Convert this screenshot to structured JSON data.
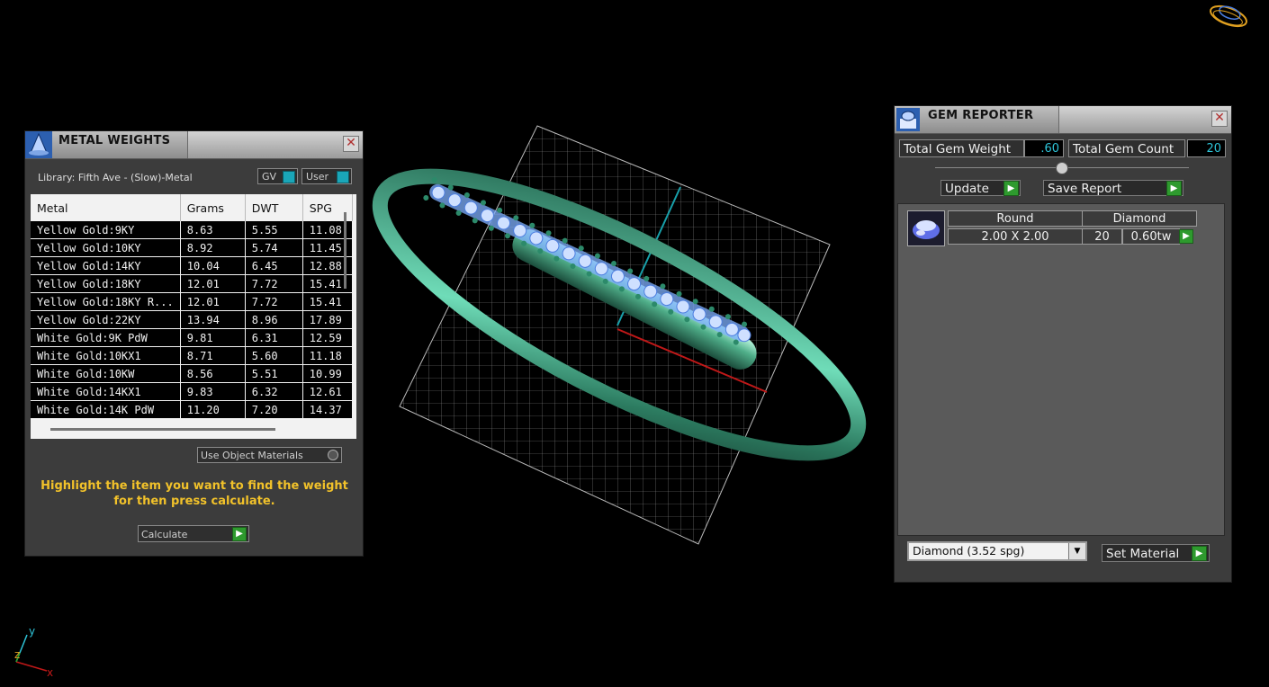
{
  "metal_weights": {
    "title": "METAL WEIGHTS",
    "library": "Library: Fifth Ave - (Slow)-Metal",
    "toggle_gv": "GV",
    "toggle_user": "User",
    "columns": [
      "Metal",
      "Grams",
      "DWT",
      "SPG"
    ],
    "rows": [
      [
        "Yellow Gold:9KY",
        "8.63",
        "5.55",
        "11.08"
      ],
      [
        "Yellow Gold:10KY",
        "8.92",
        "5.74",
        "11.45"
      ],
      [
        "Yellow Gold:14KY",
        "10.04",
        "6.45",
        "12.88"
      ],
      [
        "Yellow Gold:18KY",
        "12.01",
        "7.72",
        "15.41"
      ],
      [
        "Yellow Gold:18KY R...",
        "12.01",
        "7.72",
        "15.41"
      ],
      [
        "Yellow Gold:22KY",
        "13.94",
        "8.96",
        "17.89"
      ],
      [
        "White Gold:9K PdW",
        "9.81",
        "6.31",
        "12.59"
      ],
      [
        "White Gold:10KX1",
        "8.71",
        "5.60",
        "11.18"
      ],
      [
        "White Gold:10KW",
        "8.56",
        "5.51",
        "10.99"
      ],
      [
        "White Gold:14KX1",
        "9.83",
        "6.32",
        "12.61"
      ],
      [
        "White Gold:14K PdW",
        "11.20",
        "7.20",
        "14.37"
      ]
    ],
    "use_object_materials": "Use Object Materials",
    "hint": "Highlight the item you want to find the weight for then press calculate.",
    "calculate": "Calculate"
  },
  "gem_reporter": {
    "title": "GEM REPORTER",
    "total_weight_label": "Total Gem Weight",
    "total_weight_value": ".60",
    "total_count_label": "Total Gem Count",
    "total_count_value": "20",
    "update_label": "Update",
    "save_report_label": "Save Report",
    "gem": {
      "shape": "Round",
      "material": "Diamond",
      "size": "2.00 X 2.00",
      "count": "20",
      "weight": "0.60tw"
    },
    "material_select": "Diamond    (3.52 spg)",
    "set_material": "Set Material"
  },
  "viewport": {
    "axis_y": "y",
    "axis_z": "z",
    "axis_x": "x"
  },
  "colors": {
    "panel_bg": "#3c3c3c",
    "accent_green": "#2e9a2e",
    "accent_cyan": "#2ec4d8",
    "hint_yellow": "#f2c22a",
    "ring_green": "#3f8f6f"
  }
}
